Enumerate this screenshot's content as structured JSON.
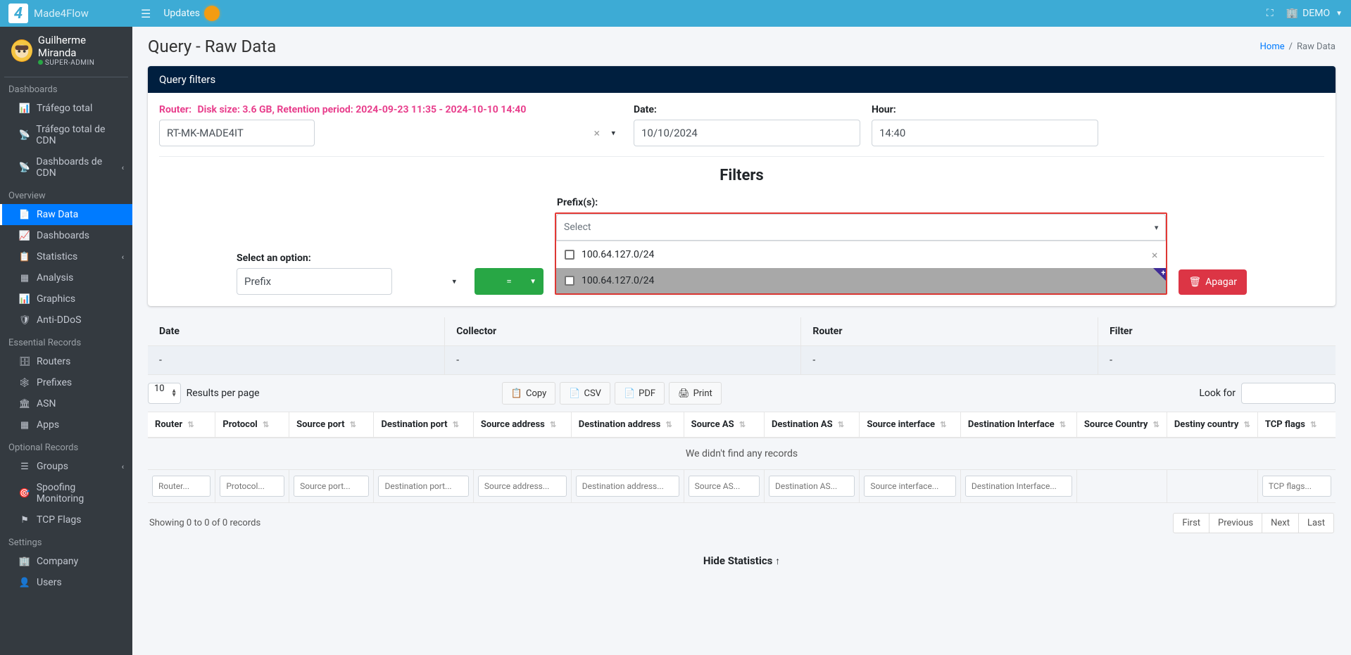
{
  "brand": "Made4Flow",
  "navbar": {
    "updates": "Updates",
    "demo": "DEMO"
  },
  "user": {
    "name": "Guilherme Miranda",
    "role": "SUPER-ADMIN"
  },
  "sidebar": {
    "sections": {
      "dashboards": "Dashboards",
      "overview": "Overview",
      "essential": "Essential Records",
      "optional": "Optional Records",
      "settings": "Settings"
    },
    "items": {
      "trafego_total": "Tráfego total",
      "trafego_cdn": "Tráfego total de CDN",
      "dashboards_cdn": "Dashboards de CDN",
      "raw_data": "Raw Data",
      "dashboards": "Dashboards",
      "statistics": "Statistics",
      "analysis": "Analysis",
      "graphics": "Graphics",
      "anti_ddos": "Anti-DDoS",
      "routers": "Routers",
      "prefixes": "Prefixes",
      "asn": "ASN",
      "apps": "Apps",
      "groups": "Groups",
      "spoofing": "Spoofing Monitoring",
      "tcp_flags": "TCP Flags",
      "company": "Company",
      "users": "Users"
    }
  },
  "header": {
    "title": "Query - Raw Data",
    "breadcrumb_home": "Home",
    "breadcrumb_current": "Raw Data"
  },
  "queryFilters": {
    "title": "Query filters",
    "router_label": "Router:",
    "disk_info": "Disk size: 3.6 GB, Retention period: 2024-09-23 11:35 - 2024-10-10 14:40",
    "router_value": "RT-MK-MADE4IT",
    "date_label": "Date:",
    "date_value": "10/10/2024",
    "hour_label": "Hour:",
    "hour_value": "14:40",
    "filters_heading": "Filters",
    "select_option_label": "Select an option:",
    "select_option_value": "Prefix",
    "operator": "=",
    "prefix_label": "Prefix(s):",
    "prefix_placeholder": "Select",
    "prefix_search_value": "100.64.127.0/24",
    "prefix_option": "100.64.127.0/24",
    "delete_btn": "Apagar"
  },
  "summaryTable": {
    "headers": {
      "date": "Date",
      "collector": "Collector",
      "router": "Router",
      "filter": "Filter"
    },
    "row": {
      "date": "-",
      "collector": "-",
      "router": "-",
      "filter": "-"
    }
  },
  "dataTable": {
    "results_per_page_value": "10",
    "results_per_page_label": "Results per page",
    "buttons": {
      "copy": "Copy",
      "csv": "CSV",
      "pdf": "PDF",
      "print": "Print"
    },
    "look_for": "Look for",
    "columns": [
      "Router",
      "Protocol",
      "Source port",
      "Destination port",
      "Source address",
      "Destination address",
      "Source AS",
      "Destination AS",
      "Source interface",
      "Destination Interface",
      "Source Country",
      "Destiny country",
      "TCP flags"
    ],
    "no_records": "We didn't find any records",
    "search_placeholders": [
      "Router...",
      "Protocol...",
      "Source port...",
      "Destination port...",
      "Source address...",
      "Destination address...",
      "Source AS...",
      "Destination AS...",
      "Source interface...",
      "Destination Interface...",
      "TCP flags..."
    ],
    "info": "Showing 0 to 0 of 0 records",
    "pagination": {
      "first": "First",
      "previous": "Previous",
      "next": "Next",
      "last": "Last"
    }
  },
  "hide_stats": "Hide Statistics"
}
